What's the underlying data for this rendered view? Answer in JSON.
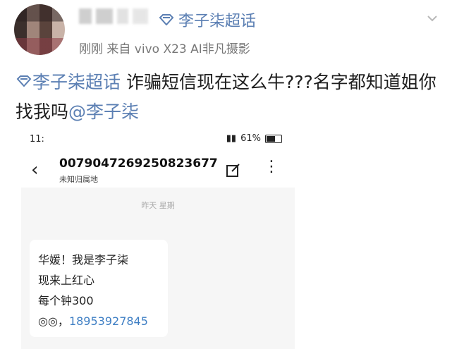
{
  "post": {
    "topic_name": "李子柒超话",
    "meta": "刚刚  来自 vivo X23 AI非凡摄影",
    "text_tag": "李子柒超话",
    "text_body": " 诈骗短信现在这么牛???名字都知道姐你找我吗",
    "text_mention": "@李子柒"
  },
  "sms": {
    "time": "11:",
    "battery": "61%",
    "number": "00790472692508236​77",
    "location": "未知归属地",
    "date": "昨天 星期",
    "line1": "华媛！我是李子柒",
    "line2": "现来上红心",
    "line3": "每个钟300",
    "phone": "18953927845"
  },
  "colors": {
    "link": "#5b7fb3",
    "phone_link": "#3f7fc4"
  }
}
